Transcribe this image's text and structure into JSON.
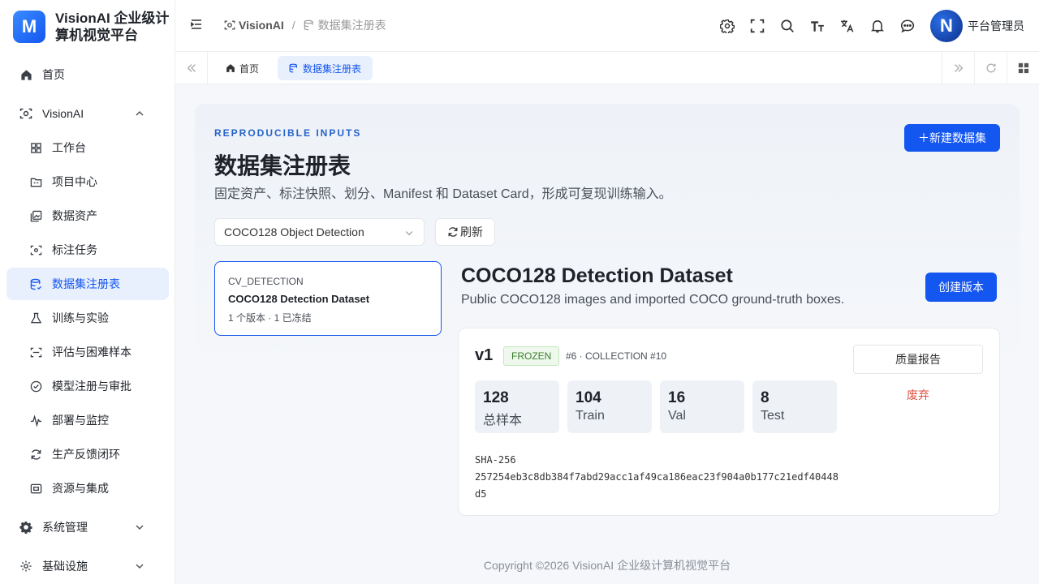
{
  "brand": {
    "logo_letter": "M",
    "title_line1": "VisionAI 企业级计",
    "title_line2": "算机视觉平台"
  },
  "sidebar": {
    "items": [
      {
        "label": "首页",
        "icon": "home-icon"
      },
      {
        "label": "VisionAI",
        "icon": "vision-icon",
        "expanded": true
      },
      {
        "label": "工作台",
        "icon": "dashboard-icon"
      },
      {
        "label": "项目中心",
        "icon": "folder-icon"
      },
      {
        "label": "数据资产",
        "icon": "images-icon"
      },
      {
        "label": "标注任务",
        "icon": "annotate-icon"
      },
      {
        "label": "数据集注册表",
        "icon": "database-icon",
        "active": true
      },
      {
        "label": "训练与实验",
        "icon": "experiment-icon"
      },
      {
        "label": "评估与困难样本",
        "icon": "scan-icon"
      },
      {
        "label": "模型注册与审批",
        "icon": "check-circle-icon"
      },
      {
        "label": "部署与监控",
        "icon": "pulse-icon"
      },
      {
        "label": "生产反馈闭环",
        "icon": "loop-icon"
      },
      {
        "label": "资源与集成",
        "icon": "integration-icon"
      },
      {
        "label": "系统管理",
        "icon": "gear-icon",
        "expanded": false
      },
      {
        "label": "基础设施",
        "icon": "infra-icon",
        "expanded": false
      }
    ]
  },
  "header": {
    "breadcrumb_home": "VisionAI",
    "breadcrumb_sep": "/",
    "breadcrumb_current": "数据集注册表",
    "user_initial": "N",
    "user_name": "平台管理员"
  },
  "tabs": [
    {
      "label": "首页",
      "icon": "home-icon"
    },
    {
      "label": "数据集注册表",
      "icon": "database-icon",
      "active": true
    }
  ],
  "page": {
    "eyebrow": "REPRODUCIBLE INPUTS",
    "title": "数据集注册表",
    "description": "固定资产、标注快照、划分、Manifest 和 Dataset Card，形成可复现训练输入。",
    "new_button": "＋新建数据集",
    "select_value": "COCO128 Object Detection",
    "refresh_label": "刷新"
  },
  "dataset_list": [
    {
      "type": "CV_DETECTION",
      "name": "COCO128 Detection Dataset",
      "meta": "1 个版本 · 1 已冻结"
    }
  ],
  "detail": {
    "title": "COCO128 Detection Dataset",
    "description": "Public COCO128 images and imported COCO ground-truth boxes.",
    "create_version_label": "创建版本",
    "version": {
      "name": "v1",
      "status": "FROZEN",
      "meta": "#6 · COLLECTION #10",
      "stats": [
        {
          "value": "128",
          "label": "总样本"
        },
        {
          "value": "104",
          "label": "Train"
        },
        {
          "value": "16",
          "label": "Val"
        },
        {
          "value": "8",
          "label": "Test"
        }
      ],
      "sha_label": "SHA-256",
      "sha_value": "257254eb3c8db384f7abd29acc1af49ca186eac23f904a0b177c21edf40448d5",
      "quality_report_label": "质量报告",
      "discard_label": "废弃"
    }
  },
  "footer": {
    "text": "Copyright ©2026 VisionAI 企业级计算机视觉平台"
  },
  "colors": {
    "primary": "#1456f0",
    "active_bg": "#e8f0fe",
    "danger": "#e0523f",
    "success": "#3a7d2e"
  }
}
